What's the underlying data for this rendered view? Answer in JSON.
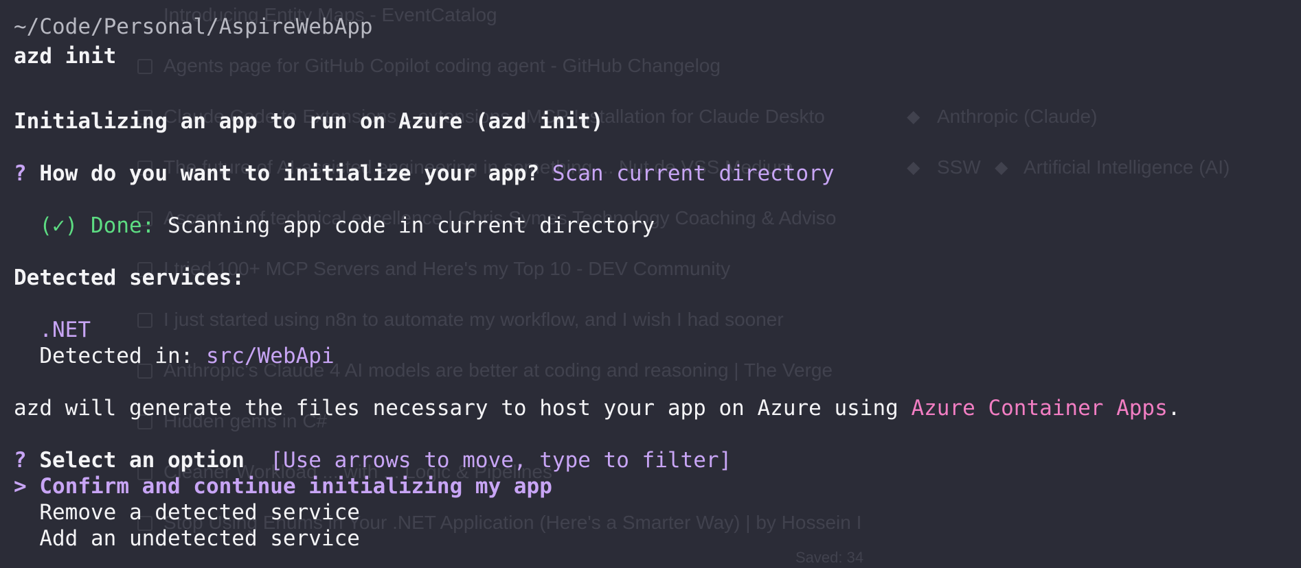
{
  "background_list": {
    "items": [
      {
        "text": "Introducing Entity Maps - EventCatalog"
      },
      {
        "text": "Agents page for GitHub Copilot coding agent - GitHub Changelog"
      },
      {
        "text": "Claude Code to Extensions ...extensions.. MCP Installation for Claude Deskto",
        "tag": "Anthropic (Claude)"
      },
      {
        "text": "The future of AI-assisted engineering in something ... Nut de VSS Medium",
        "tags": [
          "SSW",
          "Artificial Intelligence (AI)"
        ]
      },
      {
        "text": "Ascent ... of technical excellence | Chris Symes Technology Coaching & Adviso"
      },
      {
        "text": "I tried 100+ MCP Servers and Here's my Top 10 - DEV Community"
      },
      {
        "text": "I just started using n8n to automate my workflow, and I wish I had sooner"
      },
      {
        "text": "Anthropic's Claude 4 AI models are better at coding and reasoning | The Verge"
      },
      {
        "text": "Hidden gems in C#"
      },
      {
        "text": "Cleaner Workload ... with ... Logic & Pipelines"
      },
      {
        "text": "Stop Using Enums in Your .NET Application (Here's a Smarter Way) | by Hossein I"
      }
    ],
    "footer": "Saved: 34"
  },
  "terminal": {
    "cwd": "~/Code/Personal/AspireWebApp",
    "command": "azd init",
    "heading": "Initializing an app to run on Azure (azd init)",
    "prompt1": {
      "marker": "?",
      "question": "How do you want to initialize your app?",
      "answer": "Scan current directory"
    },
    "status": {
      "check": "(✓)",
      "label": "Done:",
      "message": "Scanning app code in current directory"
    },
    "detected_header": "Detected services:",
    "service": {
      "name": ".NET",
      "detected_label": "Detected in:",
      "path": "src/WebApi"
    },
    "generate": {
      "prefix": "azd will generate the files necessary to host your app on Azure using",
      "target": "Azure Container Apps",
      "suffix": "."
    },
    "prompt2": {
      "marker": "?",
      "question": "Select an option",
      "hint": "[Use arrows to move, type to filter]"
    },
    "options": {
      "cursor": ">",
      "selected": "Confirm and continue initializing my app",
      "option2": "Remove a detected service",
      "option3": "Add an undetected service"
    }
  },
  "colors": {
    "background": "#2b2c37",
    "text": "#f4f4f6",
    "accent_purple": "#c8a5f5",
    "success_green": "#5ddc82",
    "highlight_pink": "#f27ec3"
  }
}
